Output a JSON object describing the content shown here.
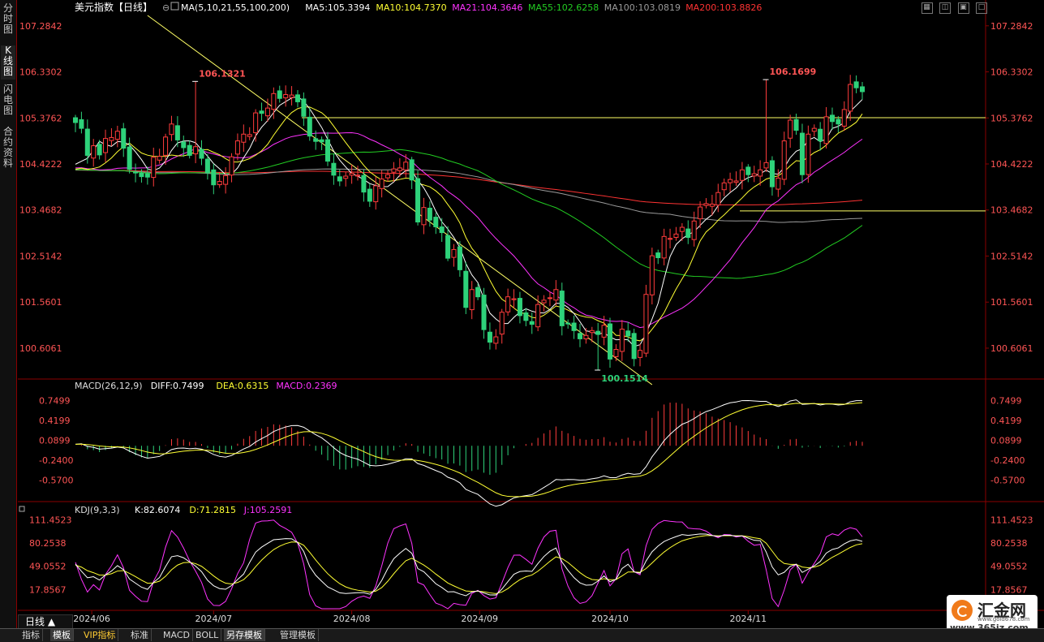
{
  "left_tabs": [
    "分时图",
    "K线图",
    "闪电图",
    "合约资料"
  ],
  "bottom_tabs": [
    "指标",
    "模板",
    "VIP指标",
    "标准",
    "MACD",
    "BOLL",
    "另存模板",
    "管理模板"
  ],
  "period_button": "日线 ▲",
  "toolbar_icons": [
    "grid-icon",
    "split-icon",
    "layout-icon",
    "window-icon"
  ],
  "logo": {
    "name": "汇金网",
    "site_small": "www.gold678.com",
    "site": "www.365jz.com"
  },
  "colors": {
    "up": "#ff3c3c",
    "down": "#2ed27a",
    "ma5": "#ffffff",
    "ma10": "#ffff33",
    "ma21": "#ff33ff",
    "ma55": "#22cc22",
    "ma100": "#9a9a9a",
    "ma200": "#ff3333",
    "hline": "#ffff66",
    "axis": "#8a0000",
    "ylabel": "#ff5555"
  },
  "main_header": {
    "title": "美元指数【日线】",
    "legend": [
      {
        "label": "MA(5,10,21,55,100,200)",
        "color": "#ffffff"
      },
      {
        "label": "MA5:105.3394",
        "color": "#ffffff"
      },
      {
        "label": "MA10:104.7370",
        "color": "#ffff33"
      },
      {
        "label": "MA21:104.3646",
        "color": "#ff33ff"
      },
      {
        "label": "MA55:102.6258",
        "color": "#22cc22"
      },
      {
        "label": "MA100:103.0819",
        "color": "#9a9a9a"
      },
      {
        "label": "MA200:103.8826",
        "color": "#ff3333"
      }
    ]
  },
  "macd_header": {
    "legend": [
      {
        "label": "MACD(26,12,9)",
        "color": "#dddddd"
      },
      {
        "label": "DIFF:0.7499",
        "color": "#ffffff"
      },
      {
        "label": "DEA:0.6315",
        "color": "#ffff33"
      },
      {
        "label": "MACD:0.2369",
        "color": "#ff33ff"
      }
    ]
  },
  "kdj_header": {
    "legend": [
      {
        "label": "KDJ(9,3,3)",
        "color": "#dddddd"
      },
      {
        "label": "K:82.6074",
        "color": "#ffffff"
      },
      {
        "label": "D:71.2815",
        "color": "#ffff33"
      },
      {
        "label": "J:105.2591",
        "color": "#ff33ff"
      }
    ]
  },
  "annotations": {
    "high_1": "106.1321",
    "low": "100.1514",
    "high_2": "106.1699"
  },
  "chart_data": [
    {
      "type": "candlestick",
      "title": "美元指数【日线】",
      "y_ticks": [
        "107.2842",
        "106.3302",
        "105.3762",
        "104.4222",
        "103.4682",
        "102.5142",
        "101.5601",
        "100.6061"
      ],
      "ylim": [
        100.0,
        107.55
      ],
      "x_ticks": [
        "2024/06",
        "2024/07",
        "2024/08",
        "2024/09",
        "2024/10",
        "2024/11"
      ],
      "horizontal_lines": [
        105.38,
        103.45
      ],
      "key_points": [
        {
          "label": "106.1321",
          "date": "2024/06/26",
          "value": 106.1321
        },
        {
          "label": "100.1514",
          "date": "2024/09/27",
          "value": 100.1514
        },
        {
          "label": "106.1699",
          "date": "2024/11/06",
          "value": 106.1699
        }
      ],
      "trend_line": {
        "from": {
          "date": "2024/06/14",
          "value": 107.5
        },
        "to": {
          "date": "2024/10/10",
          "value": 99.85
        }
      },
      "closes": [
        105.28,
        105.16,
        104.6,
        104.8,
        104.61,
        104.95,
        104.97,
        105.1,
        104.75,
        104.31,
        104.24,
        104.16,
        104.15,
        104.56,
        104.58,
        104.98,
        105.25,
        104.92,
        104.76,
        104.6,
        104.78,
        104.54,
        104.24,
        103.99,
        104.06,
        104.18,
        104.57,
        104.9,
        105.04,
        105.03,
        105.48,
        105.47,
        105.58,
        105.88,
        105.78,
        105.86,
        105.85,
        105.71,
        105.41,
        105.0,
        104.89,
        104.88,
        104.48,
        104.19,
        104.07,
        104.17,
        104.23,
        104.19,
        103.84,
        103.65,
        103.97,
        104.11,
        104.2,
        104.32,
        104.34,
        104.46,
        104.09,
        103.22,
        103.52,
        103.26,
        103.12,
        103.0,
        102.47,
        102.65,
        102.23,
        101.45,
        101.82,
        101.67,
        100.99,
        100.73,
        100.84,
        101.35,
        101.67,
        101.63,
        101.28,
        101.18,
        101.1,
        101.51,
        101.6,
        101.65,
        101.82,
        101.07,
        101.11,
        100.97,
        100.8,
        100.87,
        100.97,
        100.89,
        101.08,
        100.38,
        100.58,
        101.0,
        100.86,
        100.39,
        100.56,
        101.72,
        102.52,
        102.48,
        102.92,
        102.88,
        102.97,
        103.11,
        102.9,
        103.24,
        103.53,
        103.6,
        103.59,
        103.83,
        104.03,
        104.1,
        104.07,
        104.3,
        104.2,
        104.22,
        104.3,
        104.45,
        103.95,
        104.13,
        104.9,
        105.33,
        105.12,
        104.2,
        105.04,
        105.16,
        104.9,
        105.4,
        105.3,
        105.25,
        105.55,
        106.07,
        106.0,
        105.92
      ],
      "macd": {
        "diff_last": 0.7499,
        "dea_last": 0.6315,
        "hist_last": 0.2369,
        "y_ticks": [
          "0.7499",
          "0.4199",
          "0.0899",
          "-0.2400",
          "-0.5700"
        ]
      },
      "kdj": {
        "k_last": 82.6074,
        "d_last": 71.2815,
        "j_last": 105.2591,
        "y_ticks": [
          "111.4523",
          "80.2538",
          "49.0552",
          "17.8567"
        ]
      }
    }
  ]
}
